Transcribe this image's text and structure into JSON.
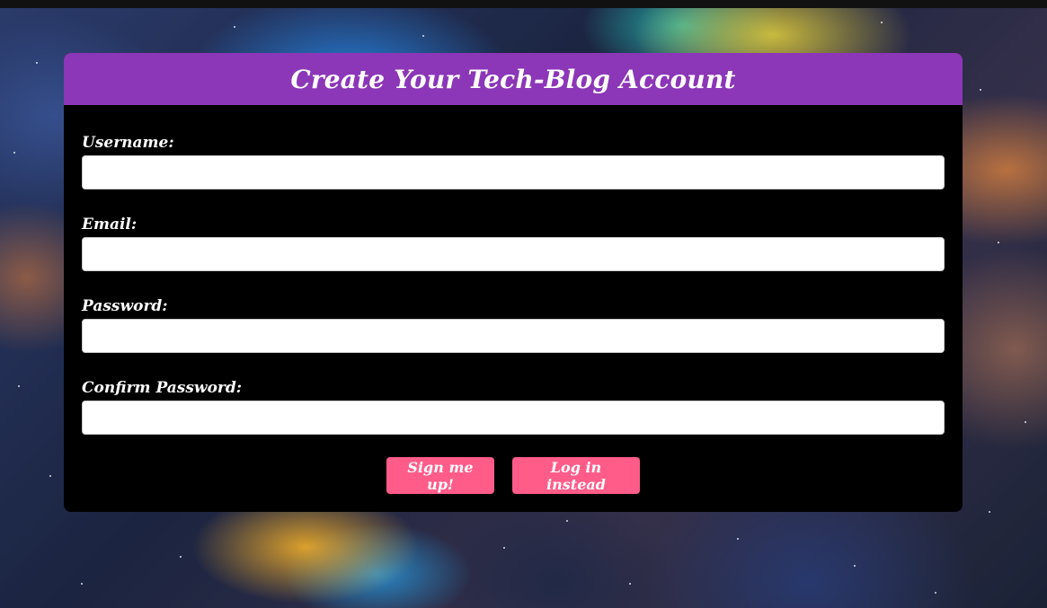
{
  "header": {
    "title": "Create Your Tech-Blog Account"
  },
  "form": {
    "fields": [
      {
        "label": "Username:",
        "value": "",
        "placeholder": ""
      },
      {
        "label": "Email:",
        "value": "",
        "placeholder": ""
      },
      {
        "label": "Password:",
        "value": "",
        "placeholder": ""
      },
      {
        "label": "Confirm Password:",
        "value": "",
        "placeholder": ""
      }
    ],
    "signup_label": "Sign me up!",
    "login_label": "Log in instead"
  },
  "colors": {
    "header_bg": "#8c36b8",
    "card_bg": "#000000",
    "button_bg": "#ff5c8a",
    "text": "#ffffff"
  }
}
